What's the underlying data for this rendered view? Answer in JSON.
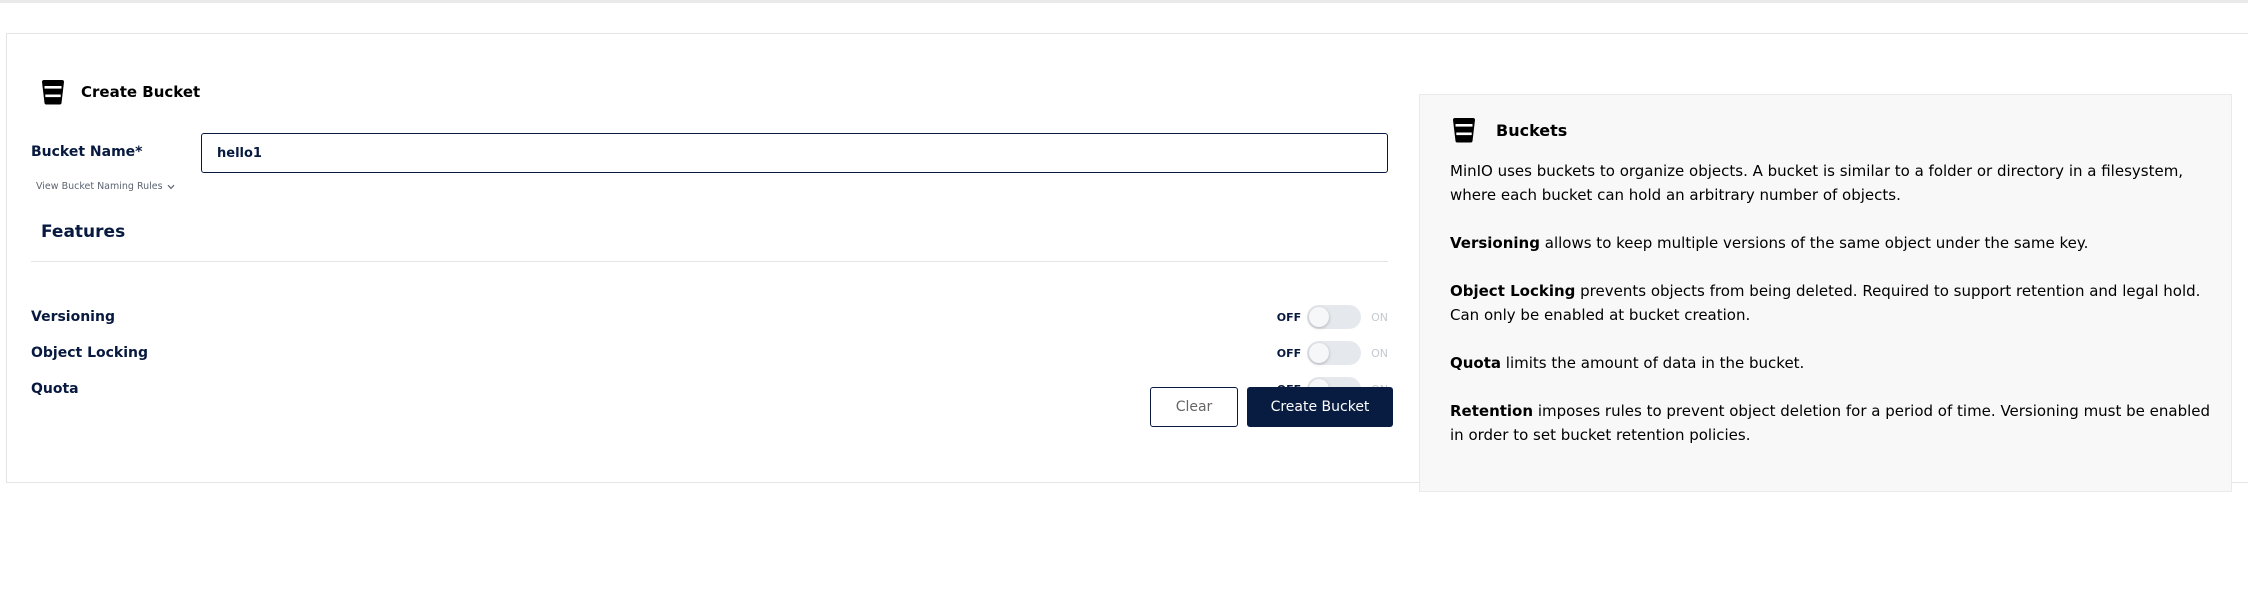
{
  "form": {
    "title": "Create Bucket",
    "bucket_icon": "bucket-icon",
    "bucket_name_label": "Bucket Name*",
    "bucket_name_value": "hello1",
    "naming_rules_link": "View Bucket Naming Rules",
    "features_title": "Features",
    "features": [
      {
        "label": "Versioning",
        "off_label": "OFF",
        "on_label": "ON",
        "enabled": false
      },
      {
        "label": "Object Locking",
        "off_label": "OFF",
        "on_label": "ON",
        "enabled": false
      },
      {
        "label": "Quota",
        "off_label": "OFF",
        "on_label": "ON",
        "enabled": false
      }
    ],
    "clear_label": "Clear",
    "create_label": "Create Bucket"
  },
  "help": {
    "title": "Buckets",
    "intro": "MinIO uses buckets to organize objects. A bucket is similar to a folder or directory in a filesystem, where each bucket can hold an arbitrary number of objects.",
    "items": [
      {
        "term": "Versioning",
        "text": " allows to keep multiple versions of the same object under the same key."
      },
      {
        "term": "Object Locking",
        "text": " prevents objects from being deleted. Required to support retention and legal hold. Can only be enabled at bucket creation."
      },
      {
        "term": "Quota",
        "text": " limits the amount of data in the bucket."
      },
      {
        "term": "Retention",
        "text": " imposes rules to prevent object deletion for a period of time. Versioning must be enabled in order to set bucket retention policies."
      }
    ]
  },
  "colors": {
    "primary": "#081c42",
    "label": "#07193e",
    "panel_bg": "#f8f8f8",
    "switch_track": "#e5e9ed"
  }
}
